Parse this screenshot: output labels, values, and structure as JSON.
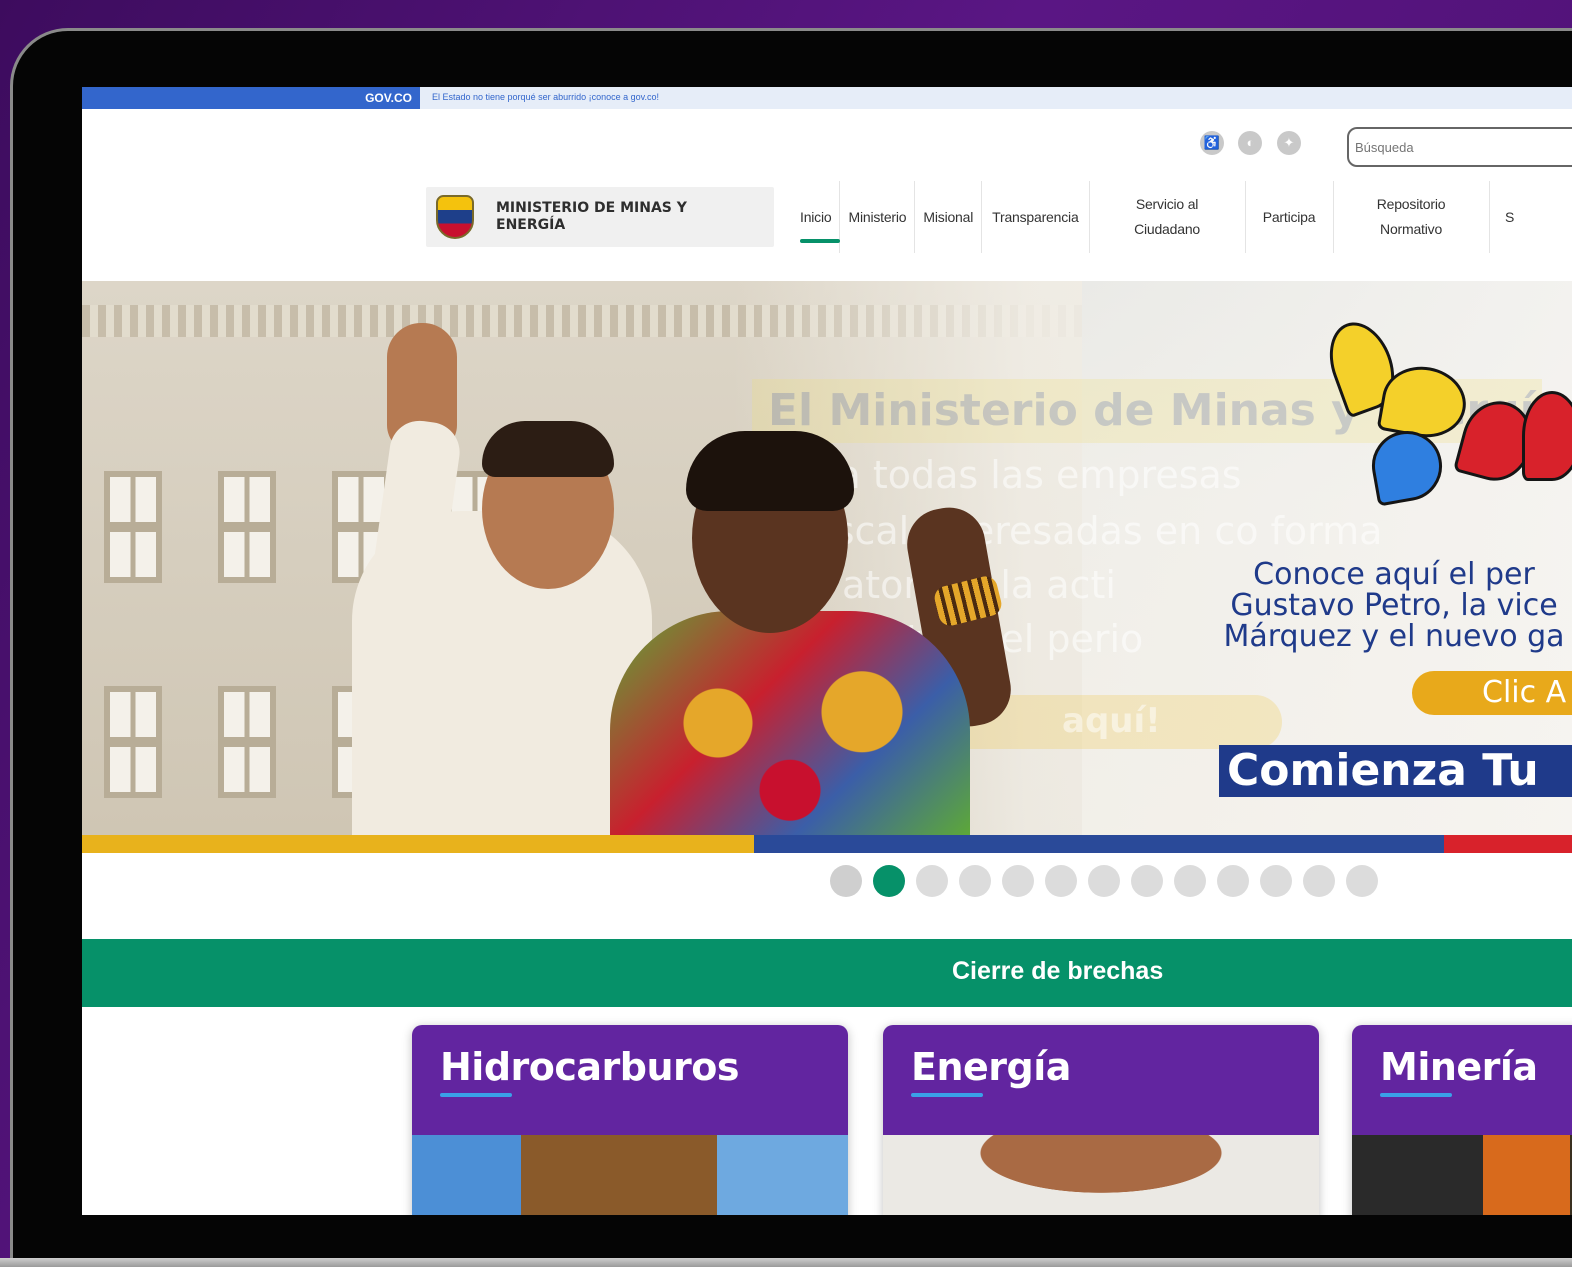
{
  "gov_bar": {
    "logo": "GOV.CO",
    "message": "El Estado no tiene porqué ser aburrido ¡conoce a gov.co!"
  },
  "header": {
    "search_placeholder": "Búsqueda",
    "brand_name": "MINISTERIO DE MINAS Y ENERGÍA",
    "nav": [
      {
        "label": "Inicio",
        "active": true
      },
      {
        "label": "Ministerio"
      },
      {
        "label": "Misional"
      },
      {
        "label": "Transparencia"
      },
      {
        "label": "Servicio al\nCiudadano"
      },
      {
        "label": "Participa"
      },
      {
        "label": "Repositorio\nNormativo"
      },
      {
        "label": "S"
      }
    ],
    "accessibility_icons": [
      "accessibility-icon",
      "contrast-icon",
      "universal-access-icon"
    ]
  },
  "hero": {
    "ghost_title": "El Ministerio de Minas y Energía",
    "ghost_lines": [
      "oca a todas las empresas",
      "sc fiscal interesadas en co forma",
      "atoria a la acti",
      "ntes del perio"
    ],
    "ghost_button": "aquí!",
    "promo_lines": [
      "Conoce aquí el per",
      "Gustavo Petro, la vice",
      "Márquez y el nuevo ga"
    ],
    "clic_label": "Clic A",
    "comienza": "Comienza Tu"
  },
  "carousel": {
    "total_dots": 13,
    "active_index": 1
  },
  "band": {
    "title": "Cierre de brechas"
  },
  "cards": [
    {
      "title": "Hidrocarburos"
    },
    {
      "title": "Energía"
    },
    {
      "title": "Minería"
    }
  ],
  "colors": {
    "gov_blue": "#3366cc",
    "green": "#069169",
    "purple": "#6225a0",
    "flag_yellow": "#e8b21c",
    "flag_blue": "#2a4a99",
    "flag_red": "#d8222b"
  }
}
